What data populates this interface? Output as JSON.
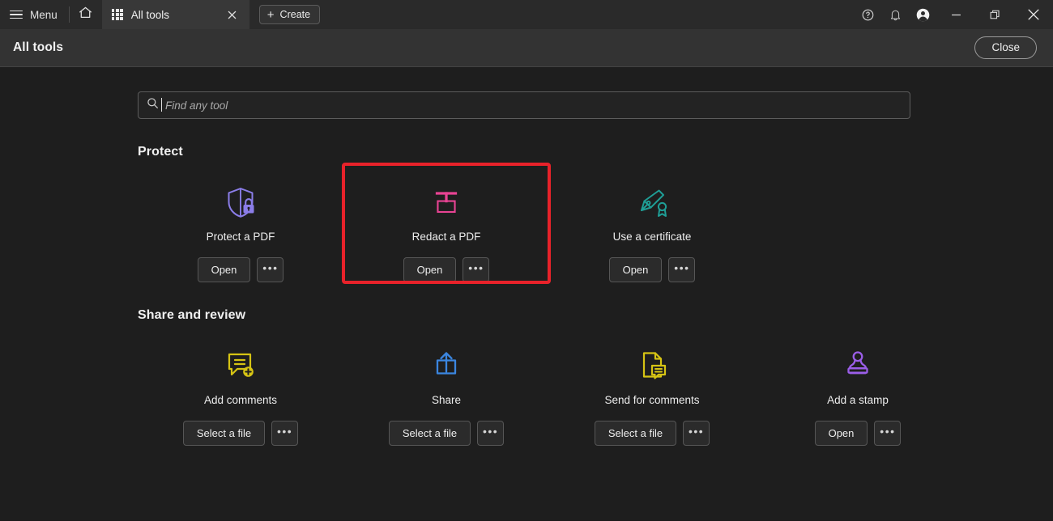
{
  "titlebar": {
    "menu_label": "Menu",
    "menu_icon": "hamburger-icon",
    "home_icon": "home-icon",
    "tab": {
      "label": "All tools",
      "grid_icon": "grid-icon",
      "close_icon": "close-icon"
    },
    "create_label": "Create",
    "create_icon": "plus-icon",
    "help_icon": "help-circle-icon",
    "bell_icon": "bell-icon",
    "account_icon": "account-avatar-icon",
    "minimize_icon": "minimize-icon",
    "restore_icon": "restore-icon",
    "close_window_icon": "close-window-icon"
  },
  "subheader": {
    "title": "All tools",
    "close_label": "Close"
  },
  "search": {
    "placeholder": "Find any tool",
    "value": "",
    "icon": "search-icon"
  },
  "sections": [
    {
      "title": "Protect",
      "tools": [
        {
          "label": "Protect a PDF",
          "icon": "shield-lock-icon",
          "color": "#8b7de8",
          "primary_action": "Open",
          "menu_icon": "overflow-dots-icon",
          "highlighted": false
        },
        {
          "label": "Redact a PDF",
          "icon": "redact-marker-icon",
          "color": "#e84393",
          "primary_action": "Open",
          "menu_icon": "overflow-dots-icon",
          "highlighted": true
        },
        {
          "label": "Use a certificate",
          "icon": "pen-certificate-icon",
          "color": "#1f9e96",
          "primary_action": "Open",
          "menu_icon": "overflow-dots-icon",
          "highlighted": false
        }
      ]
    },
    {
      "title": "Share and review",
      "tools": [
        {
          "label": "Add comments",
          "icon": "comment-plus-icon",
          "color": "#d6c414",
          "primary_action": "Select a file",
          "menu_icon": "overflow-dots-icon",
          "highlighted": false
        },
        {
          "label": "Share",
          "icon": "share-upload-icon",
          "color": "#3b86e0",
          "primary_action": "Select a file",
          "menu_icon": "overflow-dots-icon",
          "highlighted": false
        },
        {
          "label": "Send for comments",
          "icon": "document-comment-icon",
          "color": "#d6c414",
          "primary_action": "Select a file",
          "menu_icon": "overflow-dots-icon",
          "highlighted": false
        },
        {
          "label": "Add a stamp",
          "icon": "rubber-stamp-icon",
          "color": "#9b5ee8",
          "primary_action": "Open",
          "menu_icon": "overflow-dots-icon",
          "highlighted": false
        }
      ]
    }
  ],
  "colors": {
    "highlight_box": "#e8222a",
    "titlebar_bg": "#2a2a2a",
    "subheader_bg": "#333333",
    "body_bg": "#1e1e1e"
  }
}
